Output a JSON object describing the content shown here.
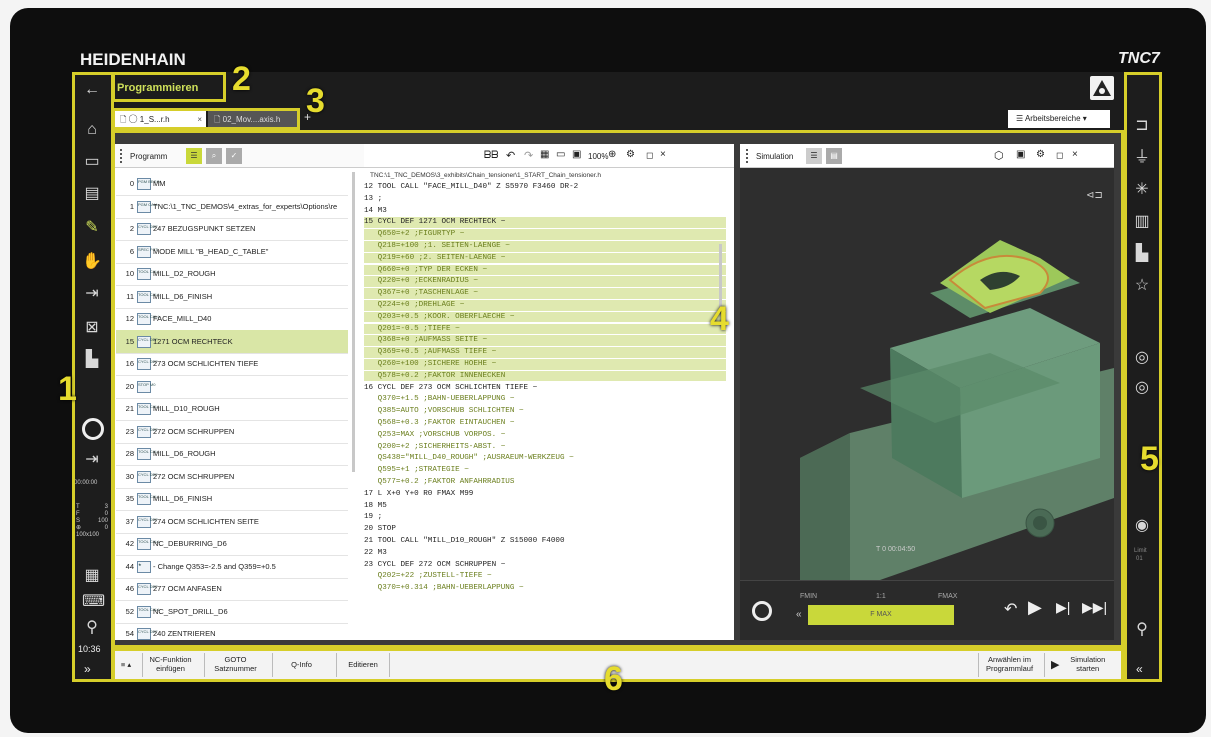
{
  "brand": "HEIDENHAIN",
  "model": "TNC7",
  "mode_title": "Programmieren",
  "tabs": [
    {
      "label": "1_S...r.h"
    },
    {
      "label": "02_Mov....axis.h"
    }
  ],
  "workspaces_label": "Arbeitsbereiche",
  "callouts": [
    "1",
    "2",
    "3",
    "4",
    "5",
    "6"
  ],
  "left_sidebar": {
    "time_elapsed": "00:00:00",
    "status": [
      {
        "k": "T",
        "v": "3"
      },
      {
        "k": "F",
        "v": "0"
      },
      {
        "k": "S",
        "v": "100"
      },
      {
        "k": "⊕",
        "v": "0"
      }
    ],
    "status_extra": "100x100",
    "clock": "10:36",
    "more": "»"
  },
  "program_panel": {
    "title": "Programm",
    "zoom": "100%",
    "rows": [
      {
        "n": "0",
        "icon": "PGM BEGIN",
        "label": "MM"
      },
      {
        "n": "1",
        "icon": "PGM CALL",
        "label": "TNC:\\1_TNC_DEMOS\\4_extras_for_experts\\Options\\re"
      },
      {
        "n": "2",
        "icon": "CYCL DEF",
        "label": "247 BEZUGSPUNKT SETZEN"
      },
      {
        "n": "6",
        "icon": "SPEC FCT",
        "label": "MODE MILL \"B_HEAD_C_TABLE\""
      },
      {
        "n": "10",
        "icon": "TOOL CALL",
        "label": "MILL_D2_ROUGH"
      },
      {
        "n": "11",
        "icon": "TOOL CALL",
        "label": "MILL_D6_FINISH"
      },
      {
        "n": "12",
        "icon": "TOOL CALL",
        "label": "FACE_MILL_D40"
      },
      {
        "n": "15",
        "icon": "CYCL DEF",
        "label": "1271 OCM RECHTECK"
      },
      {
        "n": "16",
        "icon": "CYCL DEF",
        "label": "273 OCM SCHLICHTEN TIEFE"
      },
      {
        "n": "20",
        "icon": "STOP M0",
        "label": ""
      },
      {
        "n": "21",
        "icon": "TOOL CALL",
        "label": "MILL_D10_ROUGH"
      },
      {
        "n": "23",
        "icon": "CYCL DEF",
        "label": "272 OCM SCHRUPPEN"
      },
      {
        "n": "28",
        "icon": "TOOL CALL",
        "label": "MILL_D6_ROUGH"
      },
      {
        "n": "30",
        "icon": "CYCL DEF",
        "label": "272 OCM SCHRUPPEN"
      },
      {
        "n": "35",
        "icon": "TOOL CALL",
        "label": "MILL_D6_FINISH"
      },
      {
        "n": "37",
        "icon": "CYCL DEF",
        "label": "274 OCM SCHLICHTEN SEITE"
      },
      {
        "n": "42",
        "icon": "TOOL CALL",
        "label": "NC_DEBURRING_D6"
      },
      {
        "n": "44",
        "icon": "★",
        "label": "- Change Q353=-2.5 and Q359=+0.5"
      },
      {
        "n": "46",
        "icon": "CYCL DEF",
        "label": "277 OCM ANFASEN"
      },
      {
        "n": "52",
        "icon": "TOOL CALL",
        "label": "NC_SPOT_DRILL_D6"
      },
      {
        "n": "54",
        "icon": "CYCL DEF",
        "label": "240 ZENTRIEREN"
      }
    ]
  },
  "code_panel": {
    "path": "TNC:\\1_TNC_DEMOS\\3_exhibits\\Chain_tensioner\\1_START_Chain_tensioner.h",
    "lines": [
      {
        "t": "12 TOOL CALL \"FACE_MILL_D40\" Z S5970 F3460 DR-2",
        "hl": false,
        "sub": false
      },
      {
        "t": "13 ;",
        "hl": false,
        "sub": false
      },
      {
        "t": "14 M3",
        "hl": false,
        "sub": false
      },
      {
        "t": "15 CYCL DEF 1271 OCM RECHTECK ~",
        "hl": true,
        "sub": false
      },
      {
        "t": "   Q650=+2 ;FIGURTYP ~",
        "hl": true,
        "sub": true
      },
      {
        "t": "   Q218=+100 ;1. SEITEN-LAENGE ~",
        "hl": true,
        "sub": true
      },
      {
        "t": "   Q219=+60 ;2. SEITEN-LAENGE ~",
        "hl": true,
        "sub": true
      },
      {
        "t": "   Q660=+0 ;TYP DER ECKEN ~",
        "hl": true,
        "sub": true
      },
      {
        "t": "   Q220=+0 ;ECKENRADIUS ~",
        "hl": true,
        "sub": true
      },
      {
        "t": "   Q367=+0 ;TASCHENLAGE ~",
        "hl": true,
        "sub": true
      },
      {
        "t": "   Q224=+0 ;DREHLAGE ~",
        "hl": true,
        "sub": true
      },
      {
        "t": "   Q203=+0.5 ;KOOR. OBERFLAECHE ~",
        "hl": true,
        "sub": true
      },
      {
        "t": "   Q201=-0.5 ;TIEFE ~",
        "hl": true,
        "sub": true
      },
      {
        "t": "   Q368=+0 ;AUFMASS SEITE ~",
        "hl": true,
        "sub": true
      },
      {
        "t": "   Q369=+0.5 ;AUFMASS TIEFE ~",
        "hl": true,
        "sub": true
      },
      {
        "t": "   Q260=+100 ;SICHERE HOEHE ~",
        "hl": true,
        "sub": true
      },
      {
        "t": "   Q578=+0.2 ;FAKTOR INNENECKEN",
        "hl": true,
        "sub": true
      },
      {
        "t": "16 CYCL DEF 273 OCM SCHLICHTEN TIEFE ~",
        "hl": false,
        "sub": false
      },
      {
        "t": "   Q370=+1.5 ;BAHN-UEBERLAPPUNG ~",
        "hl": false,
        "sub": true
      },
      {
        "t": "   Q385=AUTO ;VORSCHUB SCHLICHTEN ~",
        "hl": false,
        "sub": true
      },
      {
        "t": "   Q568=+0.3 ;FAKTOR EINTAUCHEN ~",
        "hl": false,
        "sub": true
      },
      {
        "t": "   Q253=MAX ;VORSCHUB VORPOS. ~",
        "hl": false,
        "sub": true
      },
      {
        "t": "   Q200=+2 ;SICHERHEITS-ABST. ~",
        "hl": false,
        "sub": true
      },
      {
        "t": "   QS438=\"MILL_D40_ROUGH\" ;AUSRAEUM-WERKZEUG ~",
        "hl": false,
        "sub": true
      },
      {
        "t": "   Q595=+1 ;STRATEGIE ~",
        "hl": false,
        "sub": true
      },
      {
        "t": "   Q577=+0.2 ;FAKTOR ANFAHRRADIUS",
        "hl": false,
        "sub": true
      },
      {
        "t": "17 L X+0 Y+0 R0 FMAX M99",
        "hl": false,
        "sub": false
      },
      {
        "t": "18 M5",
        "hl": false,
        "sub": false
      },
      {
        "t": "19 ;",
        "hl": false,
        "sub": false
      },
      {
        "t": "20 STOP",
        "hl": false,
        "sub": false
      },
      {
        "t": "21 TOOL CALL \"MILL_D10_ROUGH\" Z S15000 F4000",
        "hl": false,
        "sub": false
      },
      {
        "t": "22 M3",
        "hl": false,
        "sub": false
      },
      {
        "t": "23 CYCL DEF 272 OCM SCHRUPPEN ~",
        "hl": false,
        "sub": false
      },
      {
        "t": "   Q202=+22 ;ZUSTELL-TIEFE ~",
        "hl": false,
        "sub": true
      },
      {
        "t": "   Q370=+0.314 ;BAHN-UEBERLAPPUNG ~",
        "hl": false,
        "sub": true
      }
    ]
  },
  "simulation": {
    "title": "Simulation",
    "tool_label": "T 0",
    "time": "00:04:50",
    "fmin": "FMIN",
    "ratio": "1:1",
    "fmax": "FMAX",
    "feed_button": "F MAX"
  },
  "right_sidebar": {
    "limit": "Limit",
    "limit_val": "01",
    "more": "«"
  },
  "bottom_bar": {
    "menu": "≡ ▴",
    "buttons": [
      {
        "label": "NC-Funktion einfügen"
      },
      {
        "label": "GOTO Satznummer"
      },
      {
        "label": "Q-Info"
      },
      {
        "label": "Editieren"
      }
    ],
    "select_run": "Anwählen im Programmlauf",
    "sim_start": "Simulation starten"
  }
}
